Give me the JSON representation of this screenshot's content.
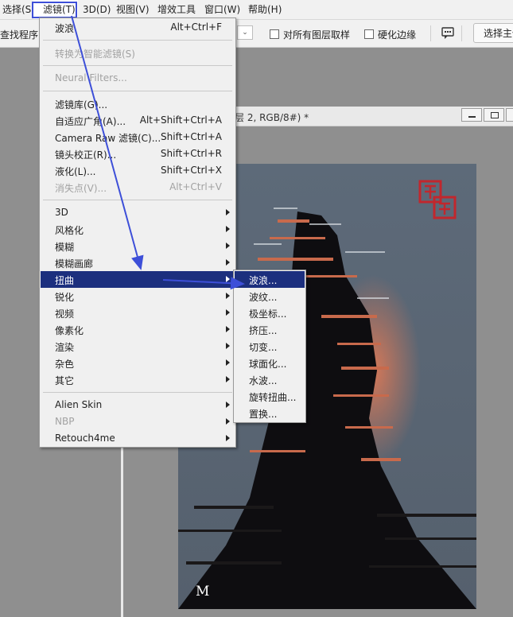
{
  "menubar": {
    "items": [
      {
        "label": "选择(S"
      },
      {
        "label": "滤镜(T)"
      },
      {
        "label": "3D(D)"
      },
      {
        "label": "视图(V)"
      },
      {
        "label": "增效工具"
      },
      {
        "label": "窗口(W)"
      },
      {
        "label": "帮助(H)"
      }
    ]
  },
  "optionsbar": {
    "find_program": "查找程序",
    "sample_all_layers": "对所有图层取样",
    "hardness_edge": "硬化边缘",
    "select_subject": "选择主体"
  },
  "document": {
    "title": "层 2, RGB/8#) *",
    "signature": "M"
  },
  "filter_menu": {
    "last_filter": {
      "label": "波浪",
      "shortcut": "Alt+Ctrl+F"
    },
    "convert_smart": {
      "label": "转换为智能滤镜(S)"
    },
    "neural_filters": {
      "label": "Neural Filters..."
    },
    "tools": [
      {
        "label": "滤镜库(G)...",
        "shortcut": ""
      },
      {
        "label": "自适应广角(A)...",
        "shortcut": "Alt+Shift+Ctrl+A"
      },
      {
        "label": "Camera Raw 滤镜(C)...",
        "shortcut": "Shift+Ctrl+A"
      },
      {
        "label": "镜头校正(R)...",
        "shortcut": "Shift+Ctrl+R"
      },
      {
        "label": "液化(L)...",
        "shortcut": "Shift+Ctrl+X"
      },
      {
        "label": "消失点(V)...",
        "shortcut": "Alt+Ctrl+V"
      }
    ],
    "categories": [
      {
        "label": "3D"
      },
      {
        "label": "风格化"
      },
      {
        "label": "模糊"
      },
      {
        "label": "模糊画廊"
      },
      {
        "label": "扭曲"
      },
      {
        "label": "锐化"
      },
      {
        "label": "视频"
      },
      {
        "label": "像素化"
      },
      {
        "label": "渲染"
      },
      {
        "label": "杂色"
      },
      {
        "label": "其它"
      }
    ],
    "plugins": [
      {
        "label": "Alien Skin"
      },
      {
        "label": "NBP"
      },
      {
        "label": "Retouch4me"
      }
    ]
  },
  "distort_submenu": {
    "items": [
      {
        "label": "波浪..."
      },
      {
        "label": "波纹..."
      },
      {
        "label": "极坐标..."
      },
      {
        "label": "挤压..."
      },
      {
        "label": "切变..."
      },
      {
        "label": "球面化..."
      },
      {
        "label": "水波..."
      },
      {
        "label": "旋转扭曲..."
      },
      {
        "label": "置换..."
      }
    ]
  },
  "colors": {
    "highlight": "#1c2f7e",
    "annotation": "#3d4fd8"
  }
}
